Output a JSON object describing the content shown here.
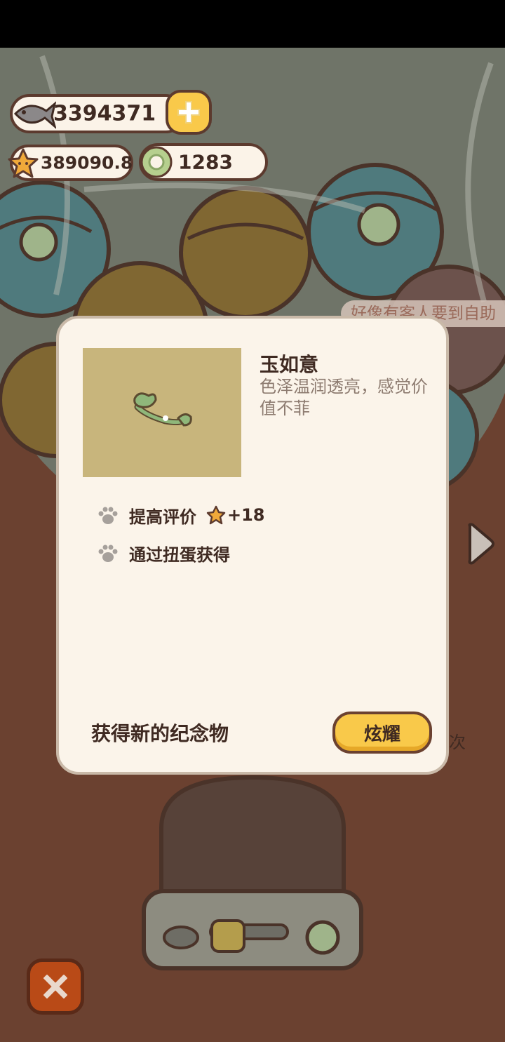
{
  "currency": {
    "fish": "3394371",
    "stars": "389090.8",
    "coins": "1283"
  },
  "notice_banner": "好像有客人要到自助",
  "side_text": "次",
  "popup": {
    "item_name": "玉如意",
    "item_description": "色泽温润透亮，感觉价值不菲",
    "effect_label": "提高评价",
    "effect_value": "+18",
    "source_label": "通过扭蛋获得",
    "footer_text": "获得新的纪念物",
    "show_button": "炫耀"
  },
  "colors": {
    "card_bg": "#fbf4ea",
    "button_yellow": "#f9c94a",
    "close_button": "#b94a17",
    "background": "#6b4130"
  }
}
